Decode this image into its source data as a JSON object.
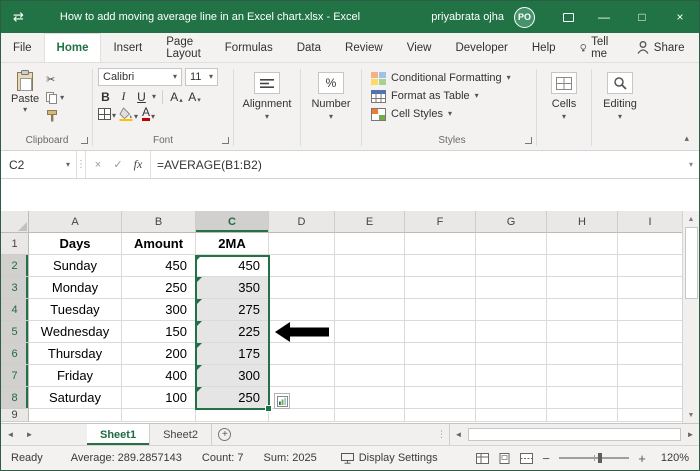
{
  "window": {
    "title": "How to add moving average line in an Excel chart.xlsx  -  Excel",
    "user_name": "priyabrata ojha",
    "avatar_initials": "PO"
  },
  "icons": {
    "quick_access": "⇄",
    "minimize": "—",
    "maximize": "□",
    "close": "×",
    "dropdown": "▾",
    "dropup": "▴",
    "collapse_ribbon": "▴",
    "left_arrow": "◄",
    "right_arrow": "►",
    "up_arrow": "▲",
    "down_arrow": "▼",
    "scissors": "✂",
    "cancel": "×",
    "check": "✓",
    "plus": "+",
    "minus": "−",
    "splitter_dots": "⋮"
  },
  "ribbon_tabs": {
    "file": "File",
    "home": "Home",
    "insert": "Insert",
    "page_layout": "Page Layout",
    "formulas": "Formulas",
    "data": "Data",
    "review": "Review",
    "view": "View",
    "developer": "Developer",
    "help": "Help",
    "tell_me": "Tell me",
    "share": "Share"
  },
  "ribbon": {
    "clipboard": {
      "label": "Clipboard",
      "paste": "Paste"
    },
    "font": {
      "label": "Font",
      "name": "Calibri",
      "size": "11",
      "bold": "B",
      "italic": "I",
      "underline": "U",
      "letter": "A"
    },
    "alignment": {
      "label": "Alignment"
    },
    "number": {
      "label": "Number",
      "percent": "%"
    },
    "styles": {
      "label": "Styles",
      "conditional_formatting": "Conditional Formatting",
      "format_as_table": "Format as Table",
      "cell_styles": "Cell Styles"
    },
    "cells": {
      "label": "Cells"
    },
    "editing": {
      "label": "Editing"
    }
  },
  "formula_bar": {
    "name_box": "C2",
    "fx": "fx",
    "formula": "=AVERAGE(B1:B2)"
  },
  "grid": {
    "columns": [
      "A",
      "B",
      "C",
      "D",
      "E",
      "F",
      "G",
      "H",
      "I"
    ],
    "rows": [
      {
        "n": "1",
        "a": "Days",
        "b": "Amount",
        "c": "2MA"
      },
      {
        "n": "2",
        "a": "Sunday",
        "b": "450",
        "c": "450"
      },
      {
        "n": "3",
        "a": "Monday",
        "b": "250",
        "c": "350"
      },
      {
        "n": "4",
        "a": "Tuesday",
        "b": "300",
        "c": "275"
      },
      {
        "n": "5",
        "a": "Wednesday",
        "b": "150",
        "c": "225"
      },
      {
        "n": "6",
        "a": "Thursday",
        "b": "200",
        "c": "175"
      },
      {
        "n": "7",
        "a": "Friday",
        "b": "400",
        "c": "300"
      },
      {
        "n": "8",
        "a": "Saturday",
        "b": "100",
        "c": "250"
      },
      {
        "n": "9",
        "a": "",
        "b": "",
        "c": ""
      }
    ],
    "selection": {
      "active_cell": "C2",
      "range": "C2:C8"
    }
  },
  "sheet_tabs": {
    "sheet1": "Sheet1",
    "sheet2": "Sheet2"
  },
  "status_bar": {
    "mode": "Ready",
    "average": "Average: 289.2857143",
    "count": "Count: 7",
    "sum": "Sum: 2025",
    "display_settings": "Display Settings",
    "zoom": "120%"
  },
  "colors": {
    "excel_green": "#217346",
    "selection_fill": "#e5e5e5",
    "title_bar": "#217346"
  }
}
